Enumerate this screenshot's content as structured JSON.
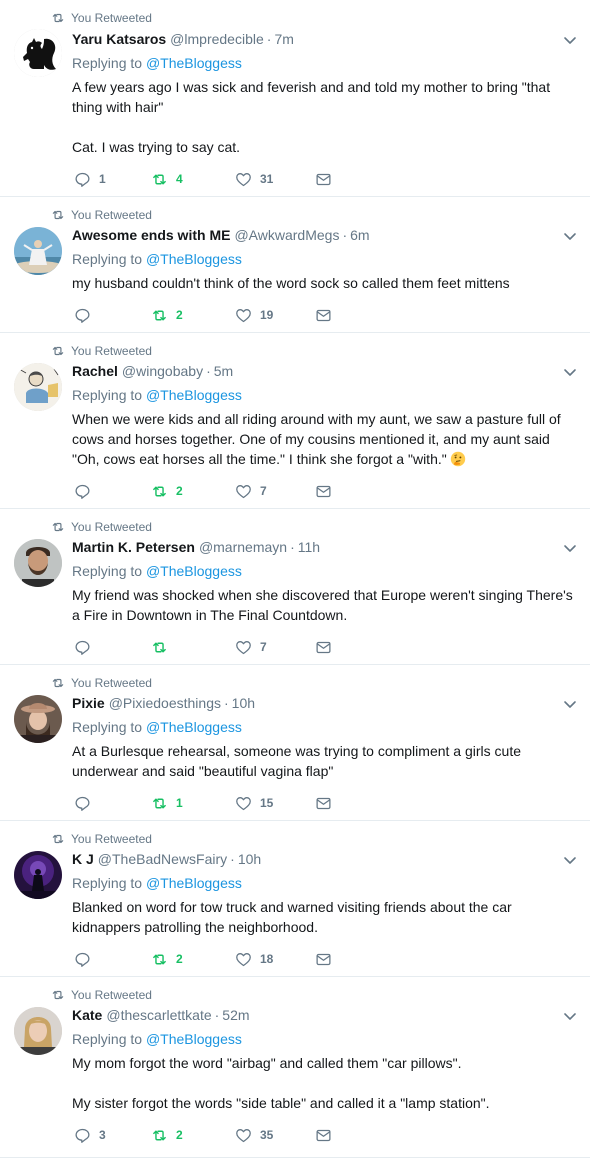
{
  "tweets": [
    {
      "rt_label": "You Retweeted",
      "name": "Yaru Katsaros",
      "handle": "@lmpredecible",
      "dot": "·",
      "time": "7m",
      "replying_prefix": "Replying to",
      "replying_to": "@TheBloggess",
      "text": [
        "A few years ago I was sick and feverish and and told my mother to bring \"that thing with hair\"",
        "Cat. I was trying to say cat."
      ],
      "replies": "1",
      "retweets": "4",
      "likes": "31"
    },
    {
      "rt_label": "You Retweeted",
      "name": "Awesome ends with ME",
      "handle": "@AwkwardMegs",
      "dot": "·",
      "time": "6m",
      "replying_prefix": "Replying to",
      "replying_to": "@TheBloggess",
      "text": [
        "my husband couldn't think of the word sock so called them feet mittens"
      ],
      "replies": "",
      "retweets": "2",
      "likes": "19"
    },
    {
      "rt_label": "You Retweeted",
      "name": "Rachel",
      "handle": "@wingobaby",
      "dot": "·",
      "time": "5m",
      "replying_prefix": "Replying to",
      "replying_to": "@TheBloggess",
      "text": [
        "When we were kids and all riding around with my aunt, we saw a pasture full of cows and horses together. One of my cousins mentioned it, and my aunt said \"Oh, cows eat horses all the time.\" I think she forgot a \"with.\""
      ],
      "emoji": "thinking-face-emoji",
      "replies": "",
      "retweets": "2",
      "likes": "7"
    },
    {
      "rt_label": "You Retweeted",
      "name": "Martin K. Petersen",
      "handle": "@marnemayn",
      "dot": "·",
      "time": "11h",
      "replying_prefix": "Replying to",
      "replying_to": "@TheBloggess",
      "text": [
        "My friend was shocked when she discovered that Europe weren't singing There's a Fire in Downtown in The Final Countdown."
      ],
      "replies": "",
      "retweets": "",
      "likes": "7"
    },
    {
      "rt_label": "You Retweeted",
      "name": "Pixie",
      "handle": "@Pixiedoesthings",
      "dot": "·",
      "time": "10h",
      "replying_prefix": "Replying to",
      "replying_to": "@TheBloggess",
      "text": [
        "At a Burlesque rehearsal, someone was trying to compliment a girls cute underwear and said \"beautiful vagina flap\""
      ],
      "replies": "",
      "retweets": "1",
      "likes": "15"
    },
    {
      "rt_label": "You Retweeted",
      "name": "K J",
      "handle": "@TheBadNewsFairy",
      "dot": "·",
      "time": "10h",
      "replying_prefix": "Replying to",
      "replying_to": "@TheBloggess",
      "text": [
        "Blanked on word for tow truck and warned visiting friends about the car kidnappers patrolling the neighborhood."
      ],
      "replies": "",
      "retweets": "2",
      "likes": "18"
    },
    {
      "rt_label": "You Retweeted",
      "name": "Kate",
      "handle": "@thescarlettkate",
      "dot": "·",
      "time": "52m",
      "replying_prefix": "Replying to",
      "replying_to": "@TheBloggess",
      "text": [
        "My mom forgot the word \"airbag\" and called them \"car pillows\".",
        "My sister forgot the words \"side table\" and called it a \"lamp station\"."
      ],
      "replies": "3",
      "retweets": "2",
      "likes": "35"
    }
  ],
  "colors": {
    "retweet_green": "#17bf63",
    "link_blue": "#1b95e0",
    "secondary_gray": "#657786",
    "divider": "#e6ecf0"
  },
  "icons": [
    "retweet-icon",
    "chevron-down-icon",
    "reply-icon",
    "heart-icon",
    "envelope-icon"
  ]
}
